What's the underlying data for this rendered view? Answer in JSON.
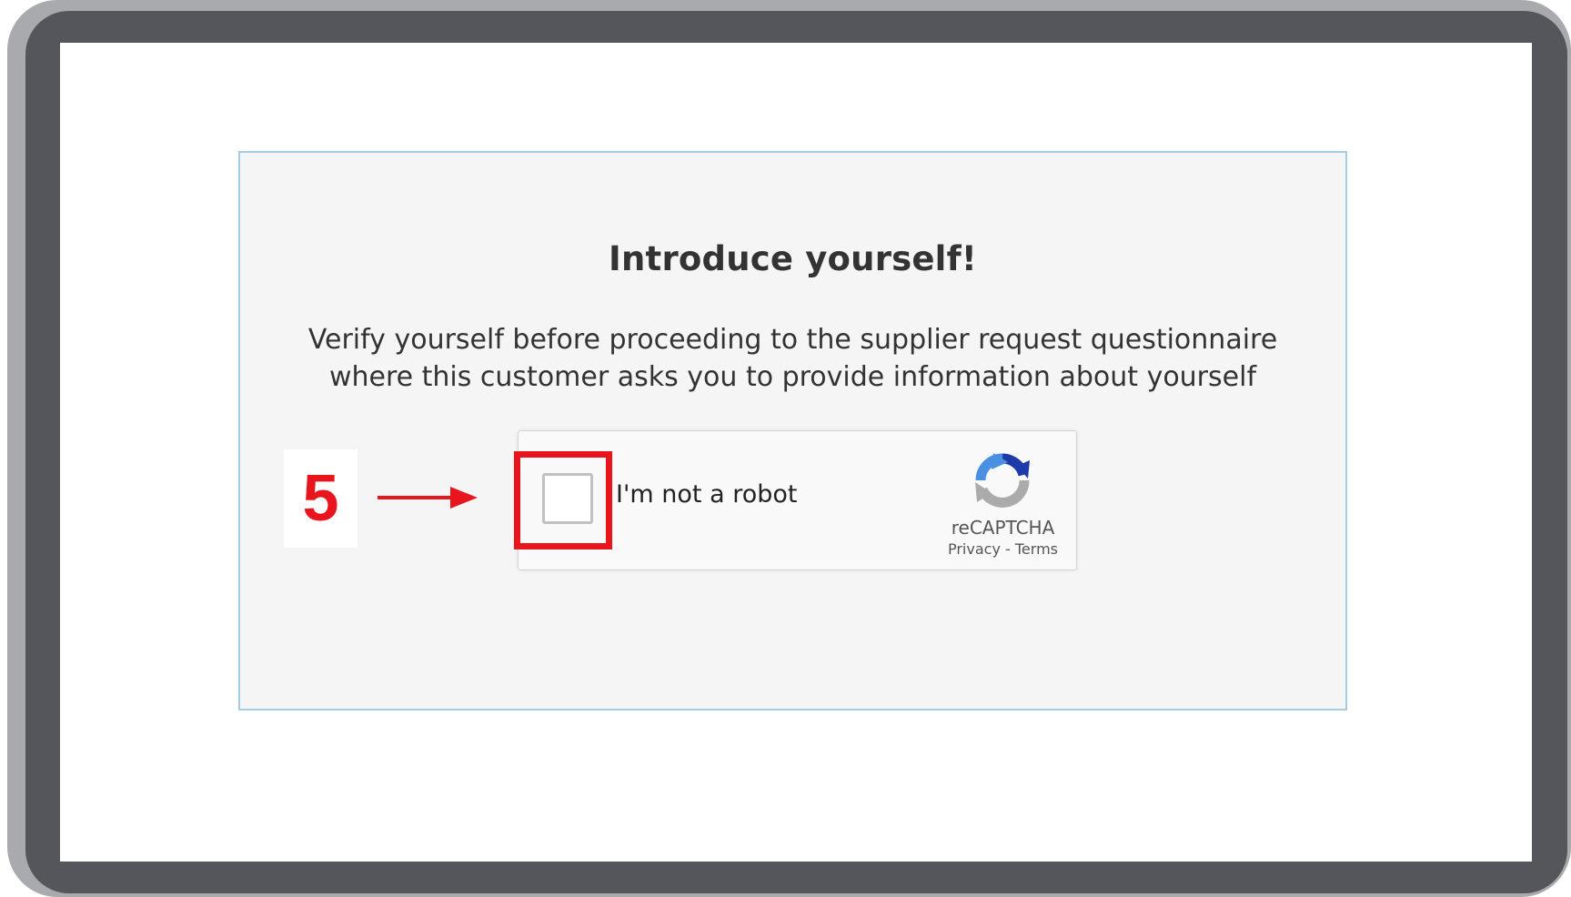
{
  "dialog": {
    "title": "Introduce yourself!",
    "description_lines": [
      "Verify yourself before proceeding to the supplier request questionnaire",
      "where this customer asks you to provide information about yourself"
    ]
  },
  "recaptcha": {
    "checkbox_label": "I'm not a robot",
    "checked": false,
    "brand": "reCAPTCHA",
    "privacy_link": "Privacy",
    "separator": " - ",
    "terms_link": "Terms",
    "logo_icon": "recaptcha-logo-icon"
  },
  "annotation": {
    "step_number": "5",
    "arrow_icon": "right-arrow-icon",
    "highlight_color": "#e8161c"
  },
  "colors": {
    "bezel": "#54565b",
    "panel_background": "#f5f5f5",
    "panel_border": "#a3cde6",
    "annotation_red": "#e8161c"
  }
}
